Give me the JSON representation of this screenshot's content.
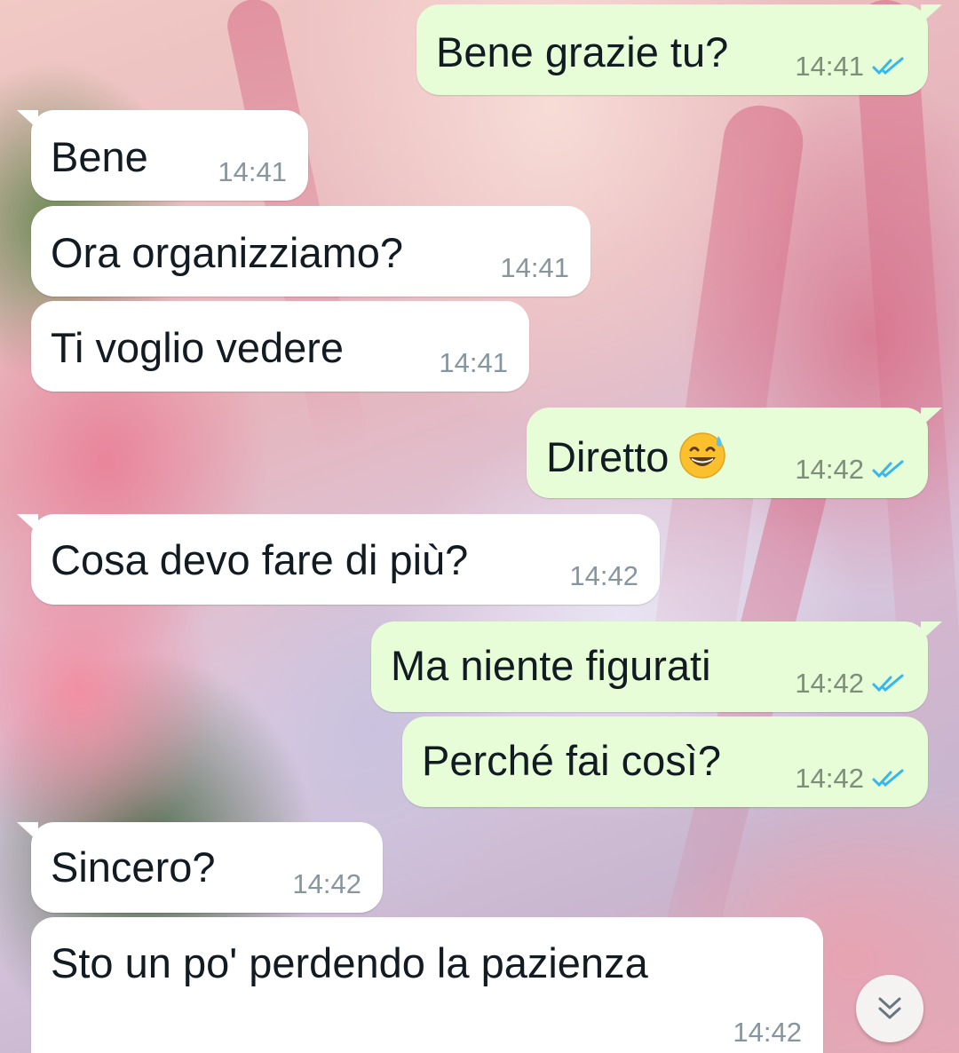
{
  "wallpaper": "anime-girl-pink-hair-flowers-wallpaper",
  "colors": {
    "incoming_bubble": "#ffffff",
    "outgoing_bubble": "#e7fdd8",
    "read_ticks": "#34b7f1",
    "timestamp": "#8696a0"
  },
  "messages": [
    {
      "direction": "out",
      "text": "Bene grazie tu?",
      "time": "14:41",
      "status": "read"
    },
    {
      "direction": "in",
      "text": "Bene",
      "time": "14:41"
    },
    {
      "direction": "in",
      "text": "Ora organizziamo?",
      "time": "14:41"
    },
    {
      "direction": "in",
      "text": "Ti voglio vedere",
      "time": "14:41"
    },
    {
      "direction": "out",
      "text": "Diretto",
      "emoji": "grinning-face-with-sweat",
      "time": "14:42",
      "status": "read"
    },
    {
      "direction": "in",
      "text": "Cosa devo fare di più?",
      "time": "14:42"
    },
    {
      "direction": "out",
      "text": "Ma niente figurati",
      "time": "14:42",
      "status": "read"
    },
    {
      "direction": "out",
      "text": "Perché fai così?",
      "time": "14:42",
      "status": "read"
    },
    {
      "direction": "in",
      "text": "Sincero?",
      "time": "14:42"
    },
    {
      "direction": "in",
      "text": "Sto un po' perdendo la pazienza",
      "time": "14:42"
    }
  ],
  "scroll_button": {
    "icon": "double-chevron-down-icon"
  }
}
